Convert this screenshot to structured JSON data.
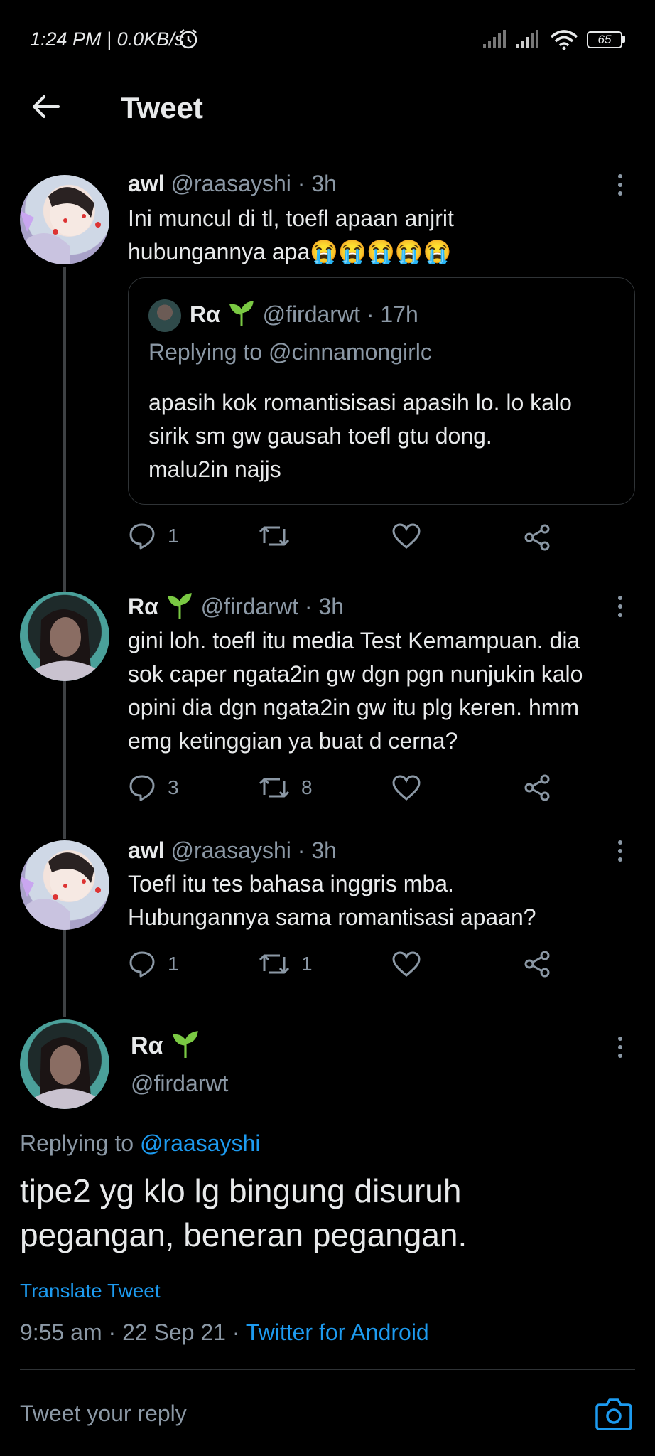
{
  "status_bar": {
    "time": "1:24 PM | 0.0KB/s",
    "battery": "65"
  },
  "header": {
    "title": "Tweet"
  },
  "thread": [
    {
      "name": "awl",
      "handle": "@raasayshi",
      "time": "· 3h",
      "text_line1": "Ini muncul di tl, toefl apaan anjrit",
      "text_line2": "hubungannya apa😭😭😭😭😭",
      "quote": {
        "name": "Rα",
        "handle": "@firdarwt",
        "time": "· 17h",
        "replying_to": "Replying to @cinnamongirlc",
        "text_lines": [
          "apasih kok romantisisasi apasih lo. lo kalo",
          "sirik sm gw gausah toefl gtu dong.",
          "malu2in najjs"
        ]
      },
      "replies": "1",
      "retweets": "",
      "likes": ""
    },
    {
      "name": "Rα",
      "handle": "@firdarwt",
      "time": "· 3h",
      "text_lines": [
        "gini loh. toefl itu media Test Kemampuan. dia",
        "sok caper ngata2in gw dgn pgn nunjukin kalo",
        "opini dia dgn ngata2in gw itu plg keren. hmm",
        "emg ketinggian ya buat d cerna?"
      ],
      "replies": "3",
      "retweets": "8",
      "likes": ""
    },
    {
      "name": "awl",
      "handle": "@raasayshi",
      "time": "· 3h",
      "text_lines": [
        "Toefl itu tes bahasa inggris mba.",
        "Hubungannya sama romantisasi apaan?"
      ],
      "replies": "1",
      "retweets": "1",
      "likes": ""
    }
  ],
  "main_tweet": {
    "name": "Rα",
    "handle": "@firdarwt",
    "replying_label": "Replying to",
    "replying_handle": "@raasayshi",
    "text_line1": "tipe2 yg klo lg bingung disuruh",
    "text_line2": "pegangan, beneran pegangan.",
    "translate": "Translate Tweet",
    "timestamp": "9:55 am · 22 Sep 21 ·",
    "source": "Twitter for Android"
  },
  "reply_bar": {
    "placeholder": "Tweet your reply"
  },
  "colors": {
    "background": "#000000",
    "accent": "#1d9bf0",
    "muted": "#8b98a5",
    "sprout": "#7ac943"
  }
}
